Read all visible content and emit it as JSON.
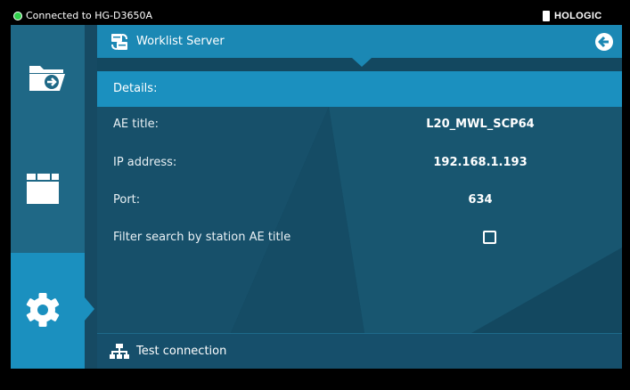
{
  "status": {
    "connection_text": "Connected to HG-D3650A",
    "brand": "HOLOGIC"
  },
  "colors": {
    "accent": "#1b90bf",
    "panel": "#134860",
    "sidebar": "#1f6886",
    "status_ok": "#2fcf4a"
  },
  "sidebar": {
    "items": [
      {
        "icon": "folder-arrow-icon",
        "active": false
      },
      {
        "icon": "window-icon",
        "active": false
      },
      {
        "icon": "gear-icon",
        "active": true
      }
    ]
  },
  "header": {
    "title": "Worklist Server",
    "icon": "server-sync-icon",
    "back_icon": "back-arrow-icon"
  },
  "details": {
    "heading": "Details:",
    "fields": [
      {
        "label": "AE title:",
        "value": "L20_MWL_SCP64"
      },
      {
        "label": "IP address:",
        "value": "192.168.1.193"
      },
      {
        "label": "Port:",
        "value": "634"
      },
      {
        "label": "Filter search by station AE title",
        "checked": false
      }
    ]
  },
  "footer": {
    "label": "Test connection",
    "icon": "network-icon"
  }
}
